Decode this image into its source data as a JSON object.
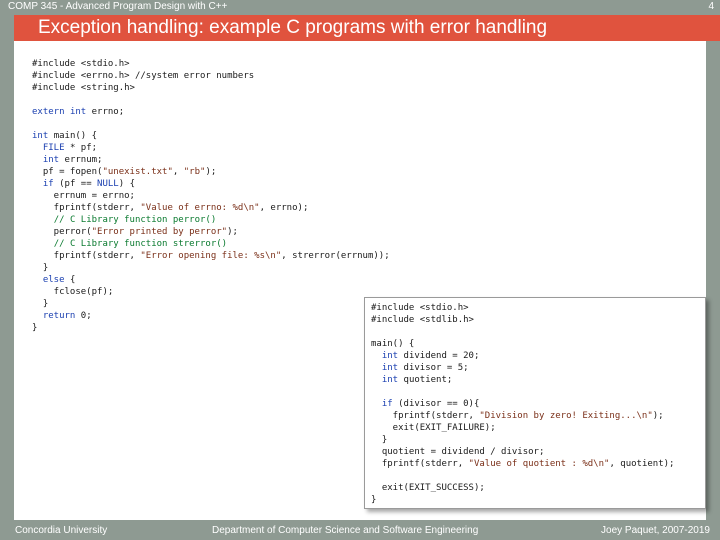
{
  "header": {
    "course": "COMP 345 - Advanced Program Design with C++",
    "page_number": "4",
    "title": "Exception handling: example C programs with error handling"
  },
  "code_left": [
    [
      {
        "t": "#include <stdio.h>"
      }
    ],
    [
      {
        "t": "#include <errno.h> //system error numbers"
      }
    ],
    [
      {
        "t": "#include <string.h>"
      }
    ],
    [],
    [
      {
        "t": "extern ",
        "c": "kw"
      },
      {
        "t": "int ",
        "c": "kw"
      },
      {
        "t": "errno;"
      }
    ],
    [],
    [
      {
        "t": "int ",
        "c": "kw"
      },
      {
        "t": "main() {"
      }
    ],
    [
      {
        "t": "  "
      },
      {
        "t": "FILE",
        "c": "kw"
      },
      {
        "t": " * pf;"
      }
    ],
    [
      {
        "t": "  "
      },
      {
        "t": "int ",
        "c": "kw"
      },
      {
        "t": "errnum;"
      }
    ],
    [
      {
        "t": "  pf = fopen("
      },
      {
        "t": "\"unexist.txt\"",
        "c": "str"
      },
      {
        "t": ", "
      },
      {
        "t": "\"rb\"",
        "c": "str"
      },
      {
        "t": ");"
      }
    ],
    [
      {
        "t": "  "
      },
      {
        "t": "if ",
        "c": "kw"
      },
      {
        "t": "(pf == "
      },
      {
        "t": "NULL",
        "c": "kw"
      },
      {
        "t": ") {"
      }
    ],
    [
      {
        "t": "    errnum = errno;"
      }
    ],
    [
      {
        "t": "    fprintf(stderr, "
      },
      {
        "t": "\"Value of errno: %d\\n\"",
        "c": "str"
      },
      {
        "t": ", errno);"
      }
    ],
    [
      {
        "t": "    "
      },
      {
        "t": "// C Library function perror()",
        "c": "cmt"
      }
    ],
    [
      {
        "t": "    perror("
      },
      {
        "t": "\"Error printed by perror\"",
        "c": "str"
      },
      {
        "t": ");"
      }
    ],
    [
      {
        "t": "    "
      },
      {
        "t": "// C Library function strerror()",
        "c": "cmt"
      }
    ],
    [
      {
        "t": "    fprintf(stderr, "
      },
      {
        "t": "\"Error opening file: %s\\n\"",
        "c": "str"
      },
      {
        "t": ", strerror(errnum));"
      }
    ],
    [
      {
        "t": "  }"
      }
    ],
    [
      {
        "t": "  "
      },
      {
        "t": "else ",
        "c": "kw"
      },
      {
        "t": "{"
      }
    ],
    [
      {
        "t": "    fclose(pf);"
      }
    ],
    [
      {
        "t": "  }"
      }
    ],
    [
      {
        "t": "  "
      },
      {
        "t": "return ",
        "c": "kw"
      },
      {
        "t": "0;"
      }
    ],
    [
      {
        "t": "}"
      }
    ]
  ],
  "code_right": [
    [
      {
        "t": "#include <stdio.h>"
      }
    ],
    [
      {
        "t": "#include <stdlib.h>"
      }
    ],
    [],
    [
      {
        "t": "main() {"
      }
    ],
    [
      {
        "t": "  "
      },
      {
        "t": "int ",
        "c": "kw"
      },
      {
        "t": "dividend = 20;"
      }
    ],
    [
      {
        "t": "  "
      },
      {
        "t": "int ",
        "c": "kw"
      },
      {
        "t": "divisor = 5;"
      }
    ],
    [
      {
        "t": "  "
      },
      {
        "t": "int ",
        "c": "kw"
      },
      {
        "t": "quotient;"
      }
    ],
    [],
    [
      {
        "t": "  "
      },
      {
        "t": "if ",
        "c": "kw"
      },
      {
        "t": "(divisor == 0){"
      }
    ],
    [
      {
        "t": "    fprintf(stderr, "
      },
      {
        "t": "\"Division by zero! Exiting...\\n\"",
        "c": "str"
      },
      {
        "t": ");"
      }
    ],
    [
      {
        "t": "    exit(EXIT_FAILURE);"
      }
    ],
    [
      {
        "t": "  }"
      }
    ],
    [
      {
        "t": "  quotient = dividend / divisor;"
      }
    ],
    [
      {
        "t": "  fprintf(stderr, "
      },
      {
        "t": "\"Value of quotient : %d\\n\"",
        "c": "str"
      },
      {
        "t": ", quotient);"
      }
    ],
    [],
    [
      {
        "t": "  exit(EXIT_SUCCESS);"
      }
    ],
    [
      {
        "t": "}"
      }
    ]
  ],
  "footer": {
    "left": "Concordia University",
    "center": "Department of Computer Science and Software Engineering",
    "right": "Joey Paquet, 2007-2019"
  }
}
